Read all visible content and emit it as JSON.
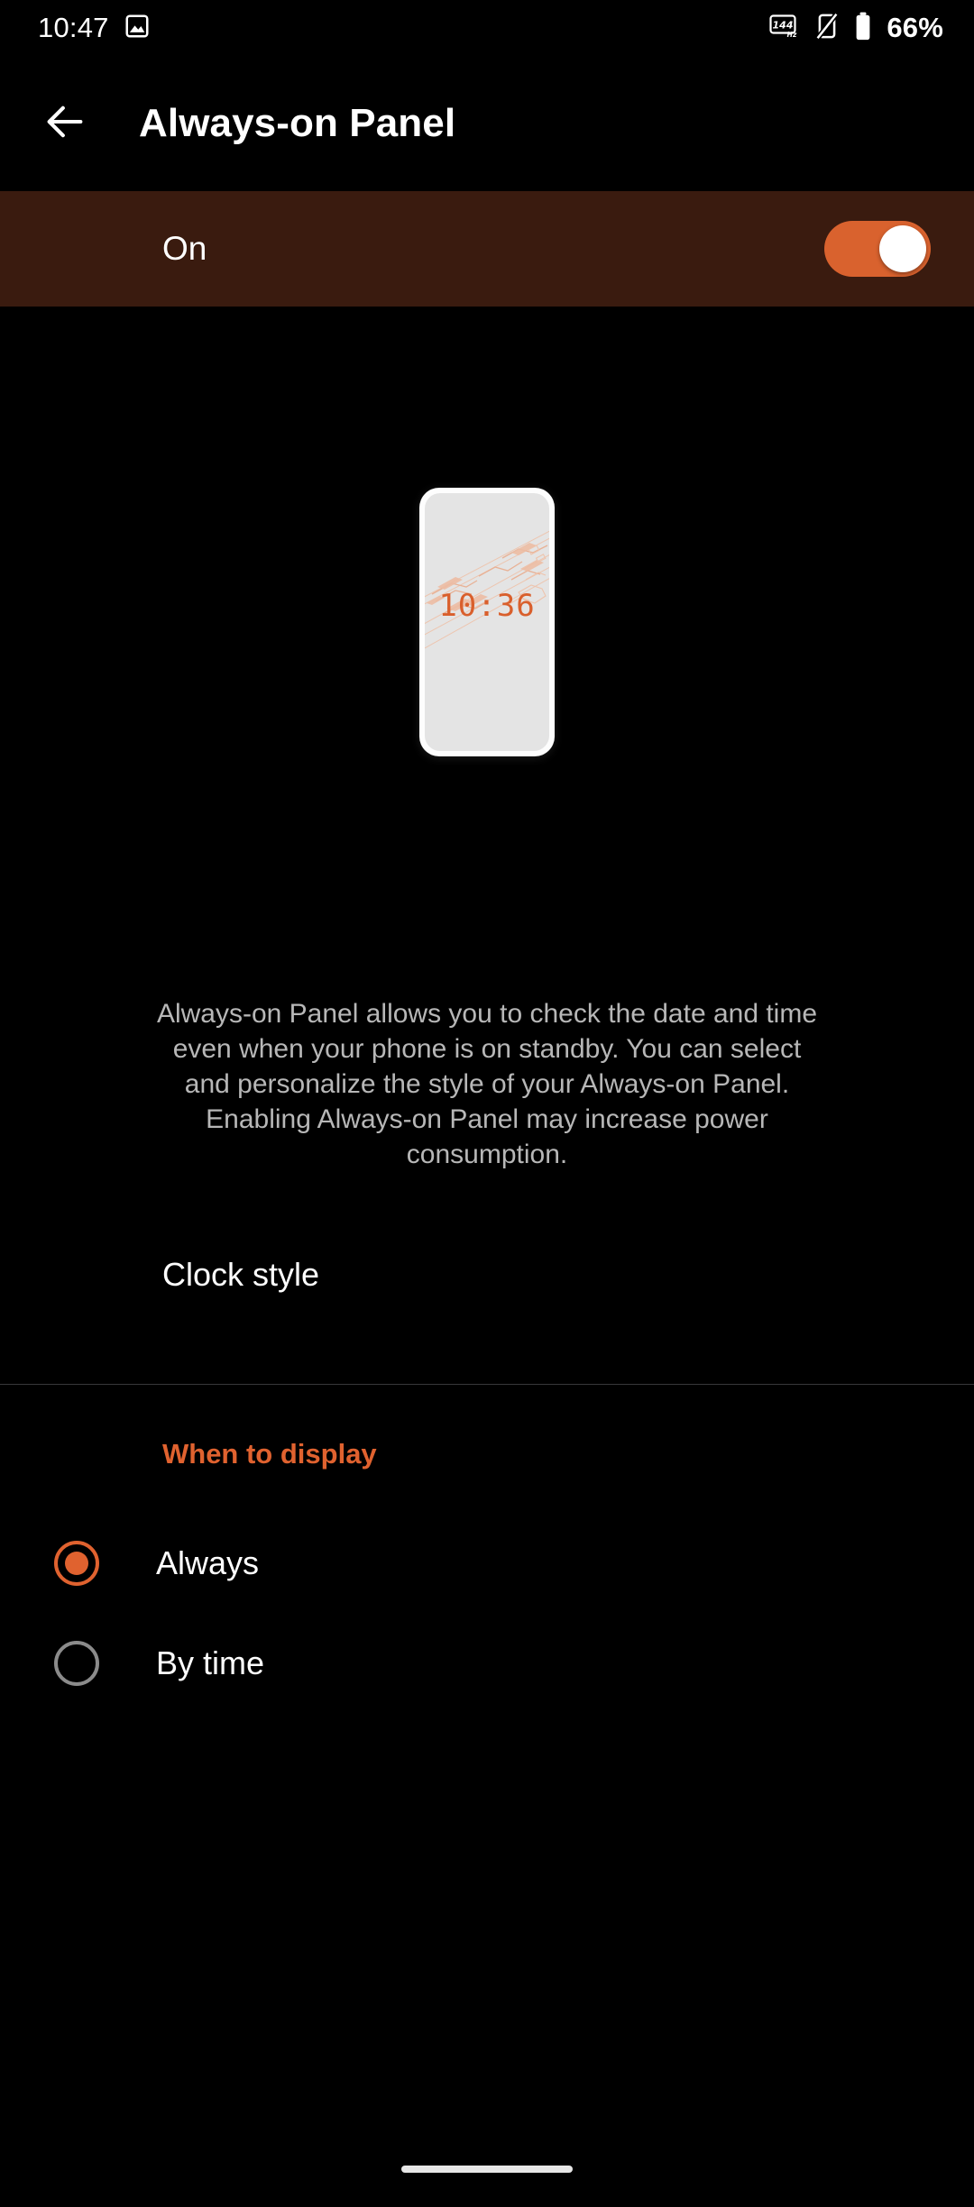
{
  "status_bar": {
    "time": "10:47",
    "left_icons": [
      {
        "name": "photo-icon"
      }
    ],
    "right_icons": [
      {
        "name": "refresh-rate-144hz-icon",
        "label": "144",
        "unit": "Hz"
      },
      {
        "name": "vibrate-off-icon"
      },
      {
        "name": "battery-icon"
      }
    ],
    "battery_percent": "66%"
  },
  "app_bar": {
    "back_icon": "back-arrow-icon",
    "title": "Always-on Panel"
  },
  "master_toggle": {
    "label": "On",
    "state": "on",
    "accent_color": "#d9622e",
    "band_color": "#3a1b0f"
  },
  "preview": {
    "clock_time": "10:36",
    "clock_color": "#d95f2c",
    "screen_color": "#e4e4e4",
    "frame_color": "#fdfdfd"
  },
  "description": "Always-on Panel allows you to check the date and time even when your phone is on standby. You can select and personalize the style of your Always-on Panel. Enabling Always-on Panel may increase power consumption.",
  "clock_style": {
    "label": "Clock style"
  },
  "when_to_display": {
    "heading": "When to display",
    "heading_color": "#e0622f",
    "options": [
      {
        "label": "Always",
        "selected": true
      },
      {
        "label": "By time",
        "selected": false
      }
    ]
  },
  "navigation": {
    "gesture_pill": "home-gesture-pill"
  }
}
